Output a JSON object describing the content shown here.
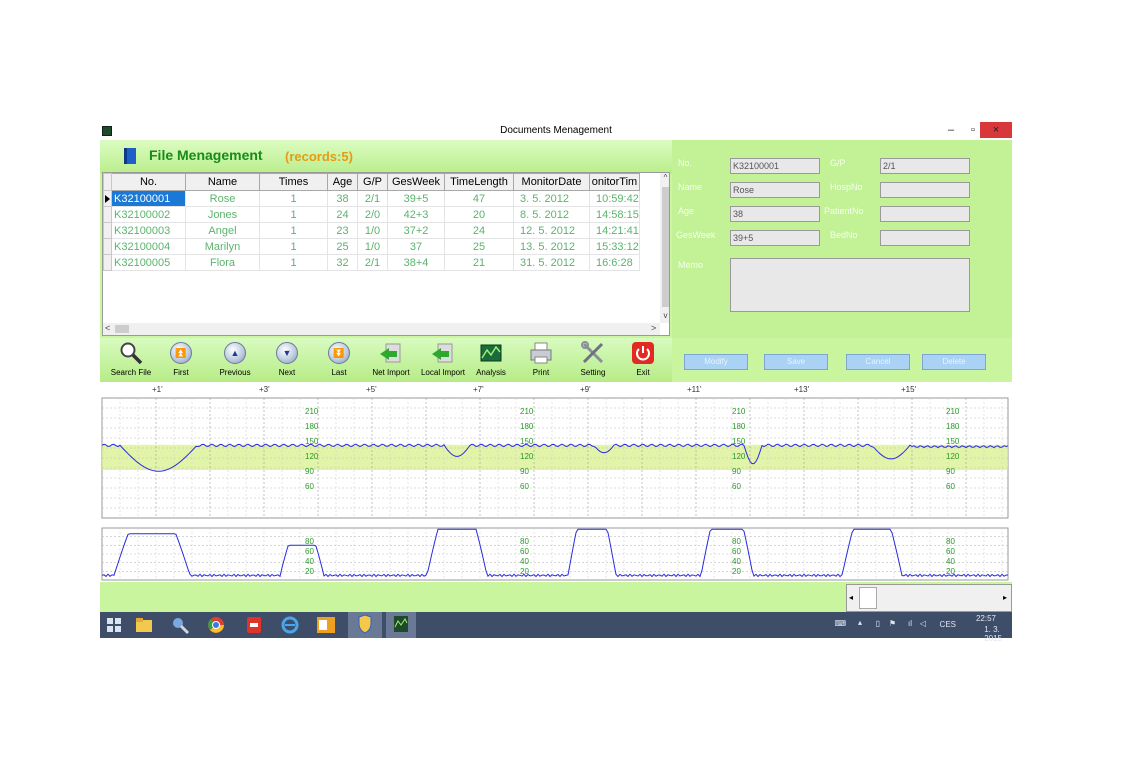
{
  "window": {
    "title": "Documents Menagement",
    "min_glyph": "–",
    "max_glyph": "▫",
    "close_glyph": "×"
  },
  "file_header": {
    "title": "File Menagement",
    "records": "(records:5)"
  },
  "grid": {
    "columns": [
      "No.",
      "Name",
      "Times",
      "Age",
      "G/P",
      "GesWeek",
      "TimeLength",
      "MonitorDate",
      "onitorTim"
    ],
    "rows": [
      [
        "K32100001",
        "Rose",
        "1",
        "38",
        "2/1",
        "39+5",
        "47",
        "3. 5. 2012",
        "10:59:42"
      ],
      [
        "K32100002",
        "Jones",
        "1",
        "24",
        "2/0",
        "42+3",
        "20",
        "8. 5. 2012",
        "14:58:15"
      ],
      [
        "K32100003",
        "Angel",
        "1",
        "23",
        "1/0",
        "37+2",
        "24",
        "12. 5. 2012",
        "14:21:41"
      ],
      [
        "K32100004",
        "Marilyn",
        "1",
        "25",
        "1/0",
        "37",
        "25",
        "13. 5. 2012",
        "15:33:12"
      ],
      [
        "K32100005",
        "Flora",
        "1",
        "32",
        "2/1",
        "38+4",
        "21",
        "31. 5. 2012",
        "16:6:28"
      ]
    ],
    "selected_row": 0
  },
  "toolbar": {
    "search": "Search File",
    "first": "First",
    "previous": "Previous",
    "next": "Next",
    "last": "Last",
    "net_import": "Net Import",
    "local_import": "Local Import",
    "analysis": "Analysis",
    "print": "Print",
    "setting": "Setting",
    "exit": "Exit"
  },
  "form": {
    "no_label": "No.",
    "no_value": "K32100001",
    "gp_label": "G/P",
    "gp_value": "2/1",
    "name_label": "Name",
    "name_value": "Rose",
    "hospno_label": "HospNo",
    "hospno_value": "",
    "age_label": "Age",
    "age_value": "38",
    "patientno_label": "PatientNo",
    "patientno_value": "",
    "gesweek_label": "GesWeek",
    "gesweek_value": "39+5",
    "bedno_label": "BedNo",
    "bedno_value": "",
    "memo_label": "Memo",
    "memo_value": ""
  },
  "form_buttons": {
    "modify": "Modify",
    "save": "Save",
    "cancel": "Cancel",
    "delete": "Delete"
  },
  "chart_labels": {
    "time_marks": [
      "+1'",
      "+3'",
      "+5'",
      "+7'",
      "+9'",
      "+11'",
      "+13'",
      "+15'"
    ],
    "fhr_ticks": [
      "210",
      "180",
      "150",
      "120",
      "90",
      "60"
    ],
    "toco_ticks": [
      "80",
      "60",
      "40",
      "20"
    ]
  },
  "colors": {
    "trace": "#2a2ae0",
    "label": "#2a9a2a",
    "normal_band": "#d8f08a"
  },
  "taskbar": {
    "keyboard": "⌨",
    "lang": "CES",
    "time": "22:57",
    "date": "1. 3. 2015"
  }
}
